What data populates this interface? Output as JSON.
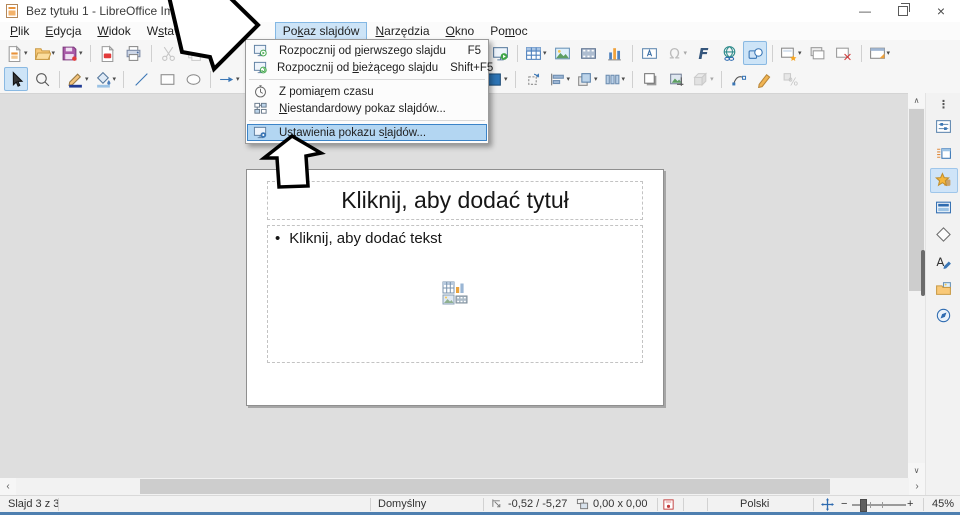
{
  "titlebar": {
    "title": "Bez tytułu 1 - LibreOffice Impress",
    "minimize_glyph": "—",
    "close_glyph": "×"
  },
  "menubar": {
    "items": [
      {
        "pre": "",
        "key": "P",
        "post": "lik"
      },
      {
        "pre": "",
        "key": "E",
        "post": "dycja"
      },
      {
        "pre": "",
        "key": "W",
        "post": "idok"
      },
      {
        "pre": "W",
        "key": "s",
        "post": "taw"
      },
      {
        "pre": "Po",
        "key": "k",
        "post": "az slajdów",
        "state": "open"
      },
      {
        "pre": "",
        "key": "N",
        "post": "arzędzia"
      },
      {
        "pre": "",
        "key": "O",
        "post": "kno"
      },
      {
        "pre": "Po",
        "key": "m",
        "post": "oc"
      }
    ]
  },
  "slideshow_menu": {
    "items": [
      {
        "icon": "start-first-slide-icon",
        "pre": "Rozpocznij od ",
        "key": "p",
        "post": "ierwszego slajdu",
        "shortcut": "F5"
      },
      {
        "icon": "start-current-slide-icon",
        "pre": "Rozpocznij od ",
        "key": "b",
        "post": "ieżącego slajdu",
        "shortcut": "Shift+F5"
      },
      {
        "icon": "rehearse-timings-icon",
        "pre": "Z pomia",
        "key": "r",
        "post": "em czasu",
        "shortcut": ""
      },
      {
        "icon": "custom-slideshow-icon",
        "pre": "",
        "key": "N",
        "post": "iestandardowy pokaz slajdów...",
        "shortcut": ""
      },
      {
        "icon": "slideshow-settings-icon",
        "pre": "Ustawienia pokazu s",
        "key": "l",
        "post": "ajdów...",
        "shortcut": "",
        "state": "highlighted"
      }
    ]
  },
  "toolbar_standard": {
    "icons": [
      "new-document",
      "open",
      "save",
      "export-pdf",
      "print",
      "cut",
      "copy",
      "paste",
      "start-slideshow",
      "insert-table",
      "insert-image",
      "insert-media",
      "insert-chart",
      "insert-textbox",
      "special-character",
      "fontwork",
      "hyperlink",
      "show-draw-functions",
      "new-slide",
      "duplicate-slide",
      "delete-slide",
      "slide-properties"
    ],
    "active_icon": "show-draw-functions"
  },
  "toolbar_drawing": {
    "icons": [
      "select",
      "zoom",
      "line-color",
      "fill-color",
      "insert-line",
      "rectangle",
      "ellipse",
      "lines-and-arrows",
      "curve",
      "fill-color-swatch",
      "rotate",
      "align",
      "arrange",
      "distribute",
      "shadow",
      "crop-image",
      "extrusion",
      "edit-points",
      "gluepoints",
      "toggle-formula"
    ],
    "active_icon": "select"
  },
  "slide": {
    "title_placeholder": "Kliknij, aby dodać tytuł",
    "bullet": "•",
    "text_placeholder": "Kliknij, aby dodać tekst"
  },
  "sidebar": {
    "icons": [
      "sidebar-settings",
      "properties",
      "slide-transition",
      "animation",
      "master-slides",
      "shapes",
      "styles",
      "gallery",
      "navigator"
    ],
    "active": "animation",
    "kebab_glyph": "⋮"
  },
  "statusbar": {
    "slide_indicator": "Slajd 3 z 3",
    "layout_name": "Domyślny",
    "cursor_position": "-0,52 / -5,27",
    "object_size": "0,00 x 0,00",
    "language": "Polski",
    "zoom_out_glyph": "−",
    "zoom_in_glyph": "+",
    "zoom_level": "45%"
  },
  "scrollbars": {
    "up_glyph": "∧",
    "down_glyph": "∨",
    "left_glyph": "‹",
    "right_glyph": "›"
  },
  "glyphs": {
    "dropdown_arrow": "▾",
    "omega": "Ω",
    "fontwork_f": "F",
    "styles_a": "A",
    "percent": "%"
  },
  "colors": {
    "selection_fill": "#cde4f7",
    "selection_border": "#84b8e4",
    "menu_highlight_fill": "#b3d6f2",
    "menu_highlight_border": "#3c84c8",
    "workspace_bg": "#dedede",
    "taskbar_edge": "#4e7fb0"
  }
}
